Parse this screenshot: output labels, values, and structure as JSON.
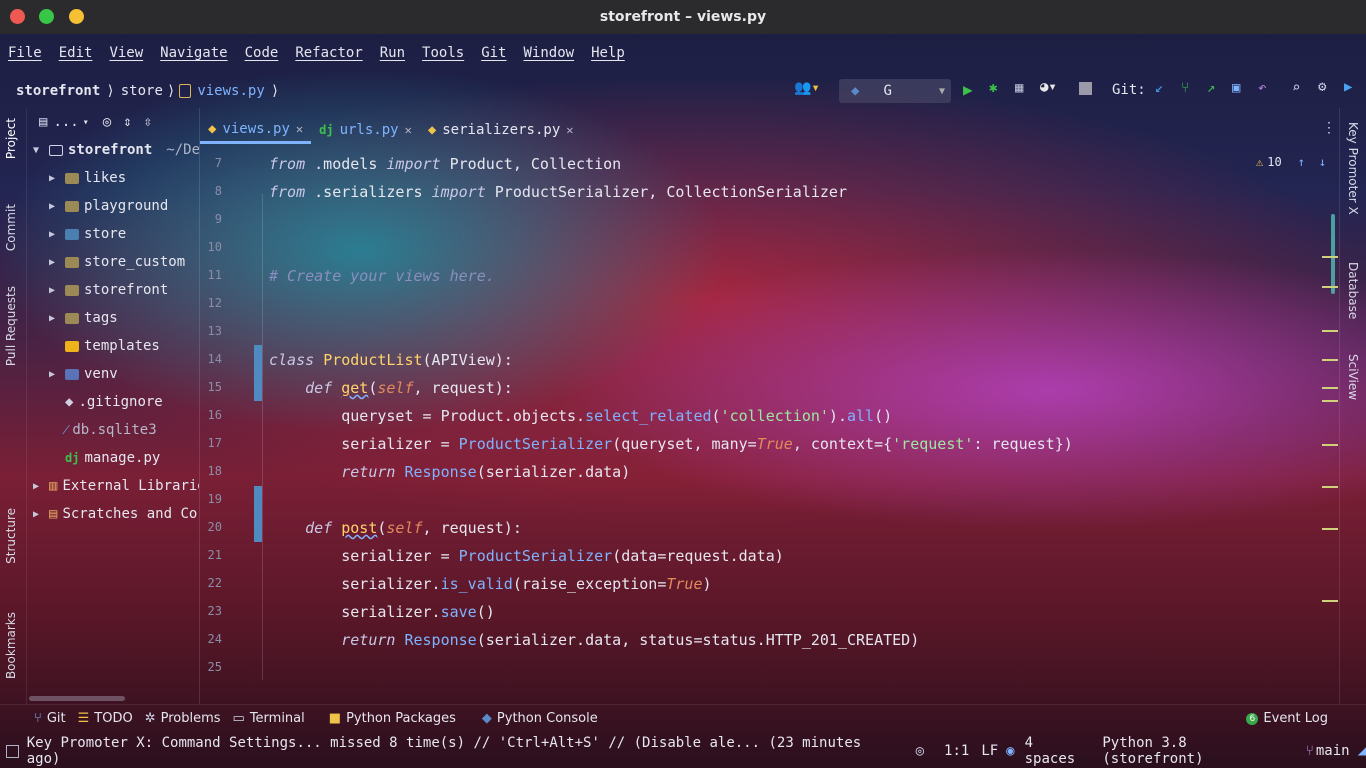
{
  "window": {
    "title": "storefront – views.py"
  },
  "menu": [
    "File",
    "Edit",
    "View",
    "Navigate",
    "Code",
    "Refactor",
    "Run",
    "Tools",
    "Git",
    "Window",
    "Help"
  ],
  "breadcrumb": {
    "project": "storefront",
    "folder": "store",
    "file": "views.py"
  },
  "toolbar": {
    "run_config": "G",
    "git_label": "Git:"
  },
  "left_tabs": [
    "Project",
    "Commit",
    "Pull Requests",
    "Structure",
    "Bookmarks"
  ],
  "right_tabs": [
    "Key Promoter X",
    "Database",
    "SciView"
  ],
  "project": {
    "header": "...",
    "root": {
      "name": "storefront",
      "path": "~/Des"
    },
    "items": [
      {
        "name": "likes",
        "kind": "folder"
      },
      {
        "name": "playground",
        "kind": "folder"
      },
      {
        "name": "store",
        "kind": "folder"
      },
      {
        "name": "store_custom",
        "kind": "folder"
      },
      {
        "name": "storefront",
        "kind": "folder"
      },
      {
        "name": "tags",
        "kind": "folder"
      },
      {
        "name": "templates",
        "kind": "folder"
      },
      {
        "name": "venv",
        "kind": "folder"
      },
      {
        "name": ".gitignore",
        "kind": "file"
      },
      {
        "name": "db.sqlite3",
        "kind": "file"
      },
      {
        "name": "manage.py",
        "kind": "file"
      }
    ],
    "external": "External Librarie",
    "scratches": "Scratches and Cor"
  },
  "tabs": [
    {
      "label": "views.py",
      "active": true
    },
    {
      "label": "urls.py",
      "active": false
    },
    {
      "label": "serializers.py",
      "active": false
    }
  ],
  "inspections": {
    "warnings": "10"
  },
  "code": {
    "line_numbers": [
      "7",
      "8",
      "9",
      "10",
      "11",
      "12",
      "13",
      "14",
      "15",
      "16",
      "17",
      "18",
      "19",
      "20",
      "21",
      "22",
      "23",
      "24",
      "25"
    ]
  },
  "bottom_tools": [
    "Git",
    "TODO",
    "Problems",
    "Terminal",
    "Python Packages",
    "Python Console"
  ],
  "event_log": {
    "count": "6",
    "label": "Event Log"
  },
  "status": {
    "message": "Key Promoter X: Command Settings... missed 8 time(s) // 'Ctrl+Alt+S' // (Disable ale... (23 minutes ago)",
    "position": "1:1",
    "line_sep": "LF",
    "indent": "4 spaces",
    "interpreter": "Python 3.8 (storefront)",
    "branch": "main"
  }
}
